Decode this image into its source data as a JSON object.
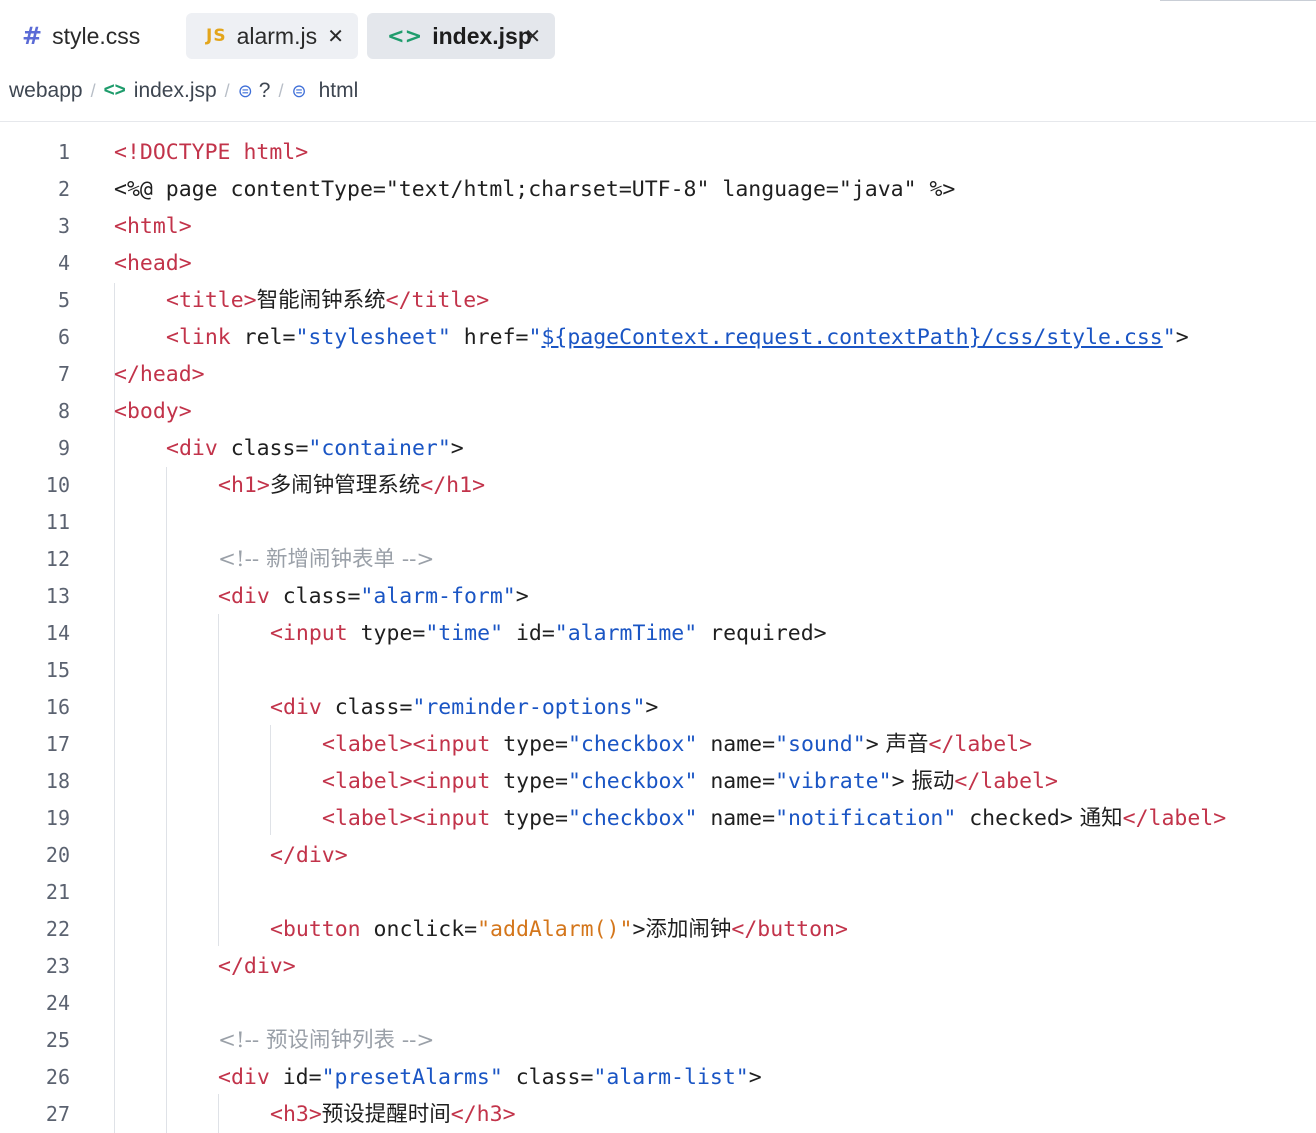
{
  "tabs": [
    {
      "icon": "#",
      "label": "style.css",
      "closable": false
    },
    {
      "icon": "JS",
      "label": "alarm.js",
      "closable": true
    },
    {
      "icon": "<>",
      "label": "index.jsp",
      "closable": true,
      "active": true
    }
  ],
  "close_glyph": "✕",
  "breadcrumb": {
    "root": "webapp",
    "separator": "/",
    "code_icon": "<>",
    "file": "index.jsp",
    "cube_icon": "⊜",
    "unknown": "?",
    "element": "html"
  },
  "editor": {
    "lines": [
      {
        "n": "1"
      },
      {
        "n": "2"
      },
      {
        "n": "3"
      },
      {
        "n": "4"
      },
      {
        "n": "5"
      },
      {
        "n": "6"
      },
      {
        "n": "7"
      },
      {
        "n": "8"
      },
      {
        "n": "9"
      },
      {
        "n": "10"
      },
      {
        "n": "11"
      },
      {
        "n": "12"
      },
      {
        "n": "13"
      },
      {
        "n": "14"
      },
      {
        "n": "15"
      },
      {
        "n": "16"
      },
      {
        "n": "17"
      },
      {
        "n": "18"
      },
      {
        "n": "19"
      },
      {
        "n": "20"
      },
      {
        "n": "21"
      },
      {
        "n": "22"
      },
      {
        "n": "23"
      },
      {
        "n": "24"
      },
      {
        "n": "25"
      },
      {
        "n": "26"
      },
      {
        "n": "27"
      }
    ],
    "code": {
      "l1": "<!DOCTYPE html>",
      "l2": "<%@ page contentType=\"text/html;charset=UTF-8\" language=\"java\" %>",
      "l3": "<html>",
      "l4": "<head>",
      "l5_title": "智能闹钟系统",
      "l6_href": "${pageContext.request.contextPath}/css/style.css",
      "l7": "</head>",
      "l8": "<body>",
      "l9_class": "\"container\"",
      "l10_h1": "多闹钟管理系统",
      "l12_comment": "<!-- 新增闹钟表单 -->",
      "l13_class": "\"alarm-form\"",
      "l14_type": "\"time\"",
      "l14_id": "\"alarmTime\"",
      "l16_class": "\"reminder-options\"",
      "l17_name": "\"sound\"",
      "l17_text": " 声音",
      "l18_name": "\"vibrate\"",
      "l18_text": " 振动",
      "l19_name": "\"notification\"",
      "l19_text": " 通知",
      "checkbox": "\"checkbox\"",
      "l22_onclick": "\"addAlarm()\"",
      "l22_text": "添加闹钟",
      "l25_comment": "<!-- 预设闹钟列表 -->",
      "l26_id": "\"presetAlarms\"",
      "l26_class": "\"alarm-list\"",
      "l27_text": "预设提醒时间"
    }
  }
}
